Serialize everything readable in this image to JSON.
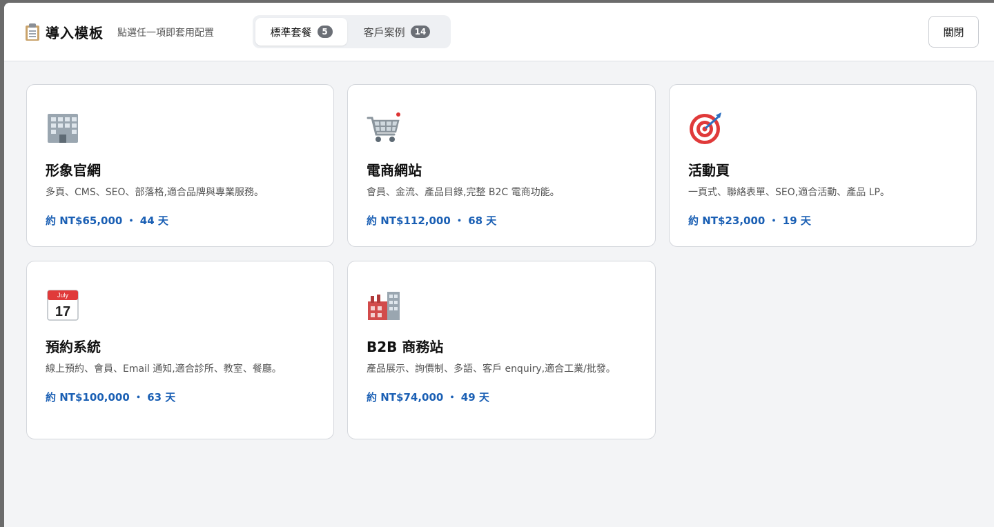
{
  "header": {
    "title": "導入模板",
    "subtitle": "點選任一項即套用配置",
    "tabs": [
      {
        "label": "標準套餐",
        "count": "5",
        "active": true
      },
      {
        "label": "客戶案例",
        "count": "14",
        "active": false
      }
    ],
    "close_label": "關閉"
  },
  "templates": [
    {
      "icon": "office-building-icon",
      "title": "形象官網",
      "desc": "多頁、CMS、SEO、部落格,適合品牌與專業服務。",
      "price": "約 NT$65,000 ・ 44 天"
    },
    {
      "icon": "shopping-cart-icon",
      "title": "電商網站",
      "desc": "會員、金流、產品目錄,完整 B2C 電商功能。",
      "price": "約 NT$112,000 ・ 68 天"
    },
    {
      "icon": "target-icon",
      "title": "活動頁",
      "desc": "一頁式、聯絡表單、SEO,適合活動、產品 LP。",
      "price": "約 NT$23,000 ・ 19 天"
    },
    {
      "icon": "calendar-icon",
      "title": "預約系統",
      "desc": "線上預約、會員、Email 通知,適合診所、教室、餐廳。",
      "price": "約 NT$100,000 ・ 63 天"
    },
    {
      "icon": "factory-icon",
      "title": "B2B 商務站",
      "desc": "產品展示、詢價制、多語、客戶 enquiry,適合工業/批發。",
      "price": "約 NT$74,000 ・ 49 天"
    }
  ],
  "calendar_icon_text": {
    "month": "July",
    "day": "17"
  },
  "colors": {
    "accent": "#1a5fb4",
    "badge": "#6b6f76",
    "background": "#f3f4f6"
  }
}
